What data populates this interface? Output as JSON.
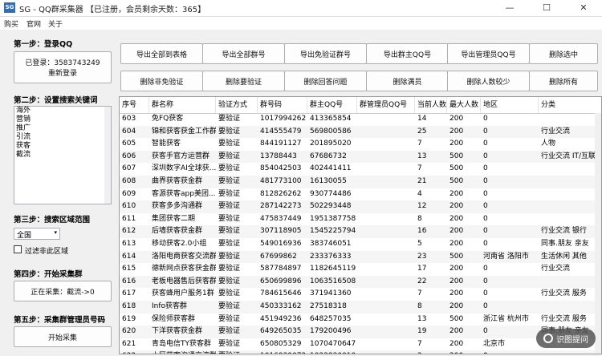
{
  "window": {
    "icon_text": "SG",
    "title": "SG - QQ群采集器 【已注册，会员剩余天数：365】",
    "minimize": "—",
    "maximize": "☐",
    "close": "✕"
  },
  "menubar": [
    "购买",
    "官网",
    "关于"
  ],
  "step1": {
    "title": "第一步：登录QQ",
    "status": "已登录：3583743249",
    "relogin": "重新登录"
  },
  "step2": {
    "title": "第二步：设置搜索关键词",
    "keywords": [
      "海外",
      "营销",
      "推广",
      "引流",
      "获客",
      "截流"
    ]
  },
  "step3": {
    "title": "第三步：搜索区域范围",
    "region": "全国",
    "filter_label": "过滤非此区域"
  },
  "step4": {
    "title": "第四步：开始采集群",
    "status": "正在采集：截流->0"
  },
  "step5": {
    "title": "第五步：采集群管理员号码",
    "start": "开始采集"
  },
  "toolbar": {
    "row1": [
      "导出全部到表格",
      "导出全部群号",
      "导出免验证群号",
      "导出群主QQ号",
      "导出管理员QQ号",
      "删除选中"
    ],
    "row2": [
      "删除非免验证",
      "删除要验证",
      "删除回答问题",
      "删除满员",
      "删除人数较少",
      "删除所有"
    ]
  },
  "table": {
    "headers": [
      "序号",
      "群名称",
      "验证方式",
      "群号码",
      "群主QQ号",
      "群管理员QQ号",
      "当前人数",
      "最大人数",
      "地区",
      "分类"
    ],
    "rows": [
      [
        "603",
        "免FQ获客",
        "要验证",
        "1017994262",
        "413365854",
        "",
        "14",
        "200",
        "0",
        ""
      ],
      [
        "604",
        "锦和获客获金工作群",
        "要验证",
        "414555479",
        "569800586",
        "",
        "25",
        "200",
        "0",
        "行业交流"
      ],
      [
        "605",
        "智能获客",
        "要验证",
        "844191127",
        "201895020",
        "",
        "7",
        "200",
        "0",
        "人物"
      ],
      [
        "606",
        "获客手官方运营群",
        "要验证",
        "13788443",
        "67686732",
        "",
        "13",
        "500",
        "0",
        "行业交流 IT/互联"
      ],
      [
        "607",
        "深圳数字AI全球获...",
        "要验证",
        "854042503",
        "402441411",
        "",
        "7",
        "500",
        "0",
        ""
      ],
      [
        "608",
        "曲界获客获金群",
        "要验证",
        "481773100",
        "16130055",
        "",
        "21",
        "500",
        "0",
        ""
      ],
      [
        "609",
        "客源获客app美团...",
        "要验证",
        "812826262",
        "930774486",
        "",
        "4",
        "200",
        "0",
        ""
      ],
      [
        "610",
        "获客多多沟通群",
        "要验证",
        "287142273",
        "502293448",
        "",
        "12",
        "200",
        "0",
        ""
      ],
      [
        "611",
        "集团获客二期",
        "要验证",
        "475837449",
        "1951387758",
        "",
        "8",
        "200",
        "0",
        ""
      ],
      [
        "612",
        "后墙获客获金群",
        "要验证",
        "307118905",
        "1545225794",
        "",
        "16",
        "200",
        "0",
        "行业交流 银行"
      ],
      [
        "613",
        "移动获客2.0小组",
        "要验证",
        "549016936",
        "383746051",
        "",
        "5",
        "200",
        "0",
        "同事.朋友 亲友"
      ],
      [
        "614",
        "洛阳电商获客交流群",
        "要验证",
        "67699862",
        "233376333",
        "",
        "23",
        "500",
        "河南省 洛阳市",
        "生活休闲 其他"
      ],
      [
        "615",
        "德新网点获客获金群",
        "要验证",
        "587784897",
        "1182645119",
        "",
        "17",
        "200",
        "0",
        "行业交流"
      ],
      [
        "616",
        "老板电器售后获客群",
        "要验证",
        "650699896",
        "1063516508",
        "",
        "22",
        "200",
        "0",
        ""
      ],
      [
        "617",
        "获客蜂用户服务1群",
        "要验证",
        "784615646",
        "371941360",
        "",
        "7",
        "200",
        "0",
        "行业交流 服务"
      ],
      [
        "618",
        "Info获客群",
        "要验证",
        "450333162",
        "27518318",
        "",
        "8",
        "200",
        "0",
        ""
      ],
      [
        "619",
        "保险师获客群",
        "要验证",
        "451949236",
        "648257035",
        "",
        "13",
        "500",
        "浙江省 杭州市",
        "行业交流 服务"
      ],
      [
        "620",
        "下洋获客获金群",
        "要验证",
        "649265035",
        "179200496",
        "",
        "19",
        "200",
        "0",
        "同事.朋友 亲友"
      ],
      [
        "621",
        "青岛电信TY获客群",
        "要验证",
        "650805329",
        "1070470647",
        "",
        "7",
        "200",
        "北京市",
        ""
      ],
      [
        "622",
        "小区获客沟通交流群",
        "要验证",
        "1016939072",
        "1023830010",
        "",
        "3",
        "200",
        "0",
        ""
      ]
    ]
  },
  "watermark": "识图提问"
}
